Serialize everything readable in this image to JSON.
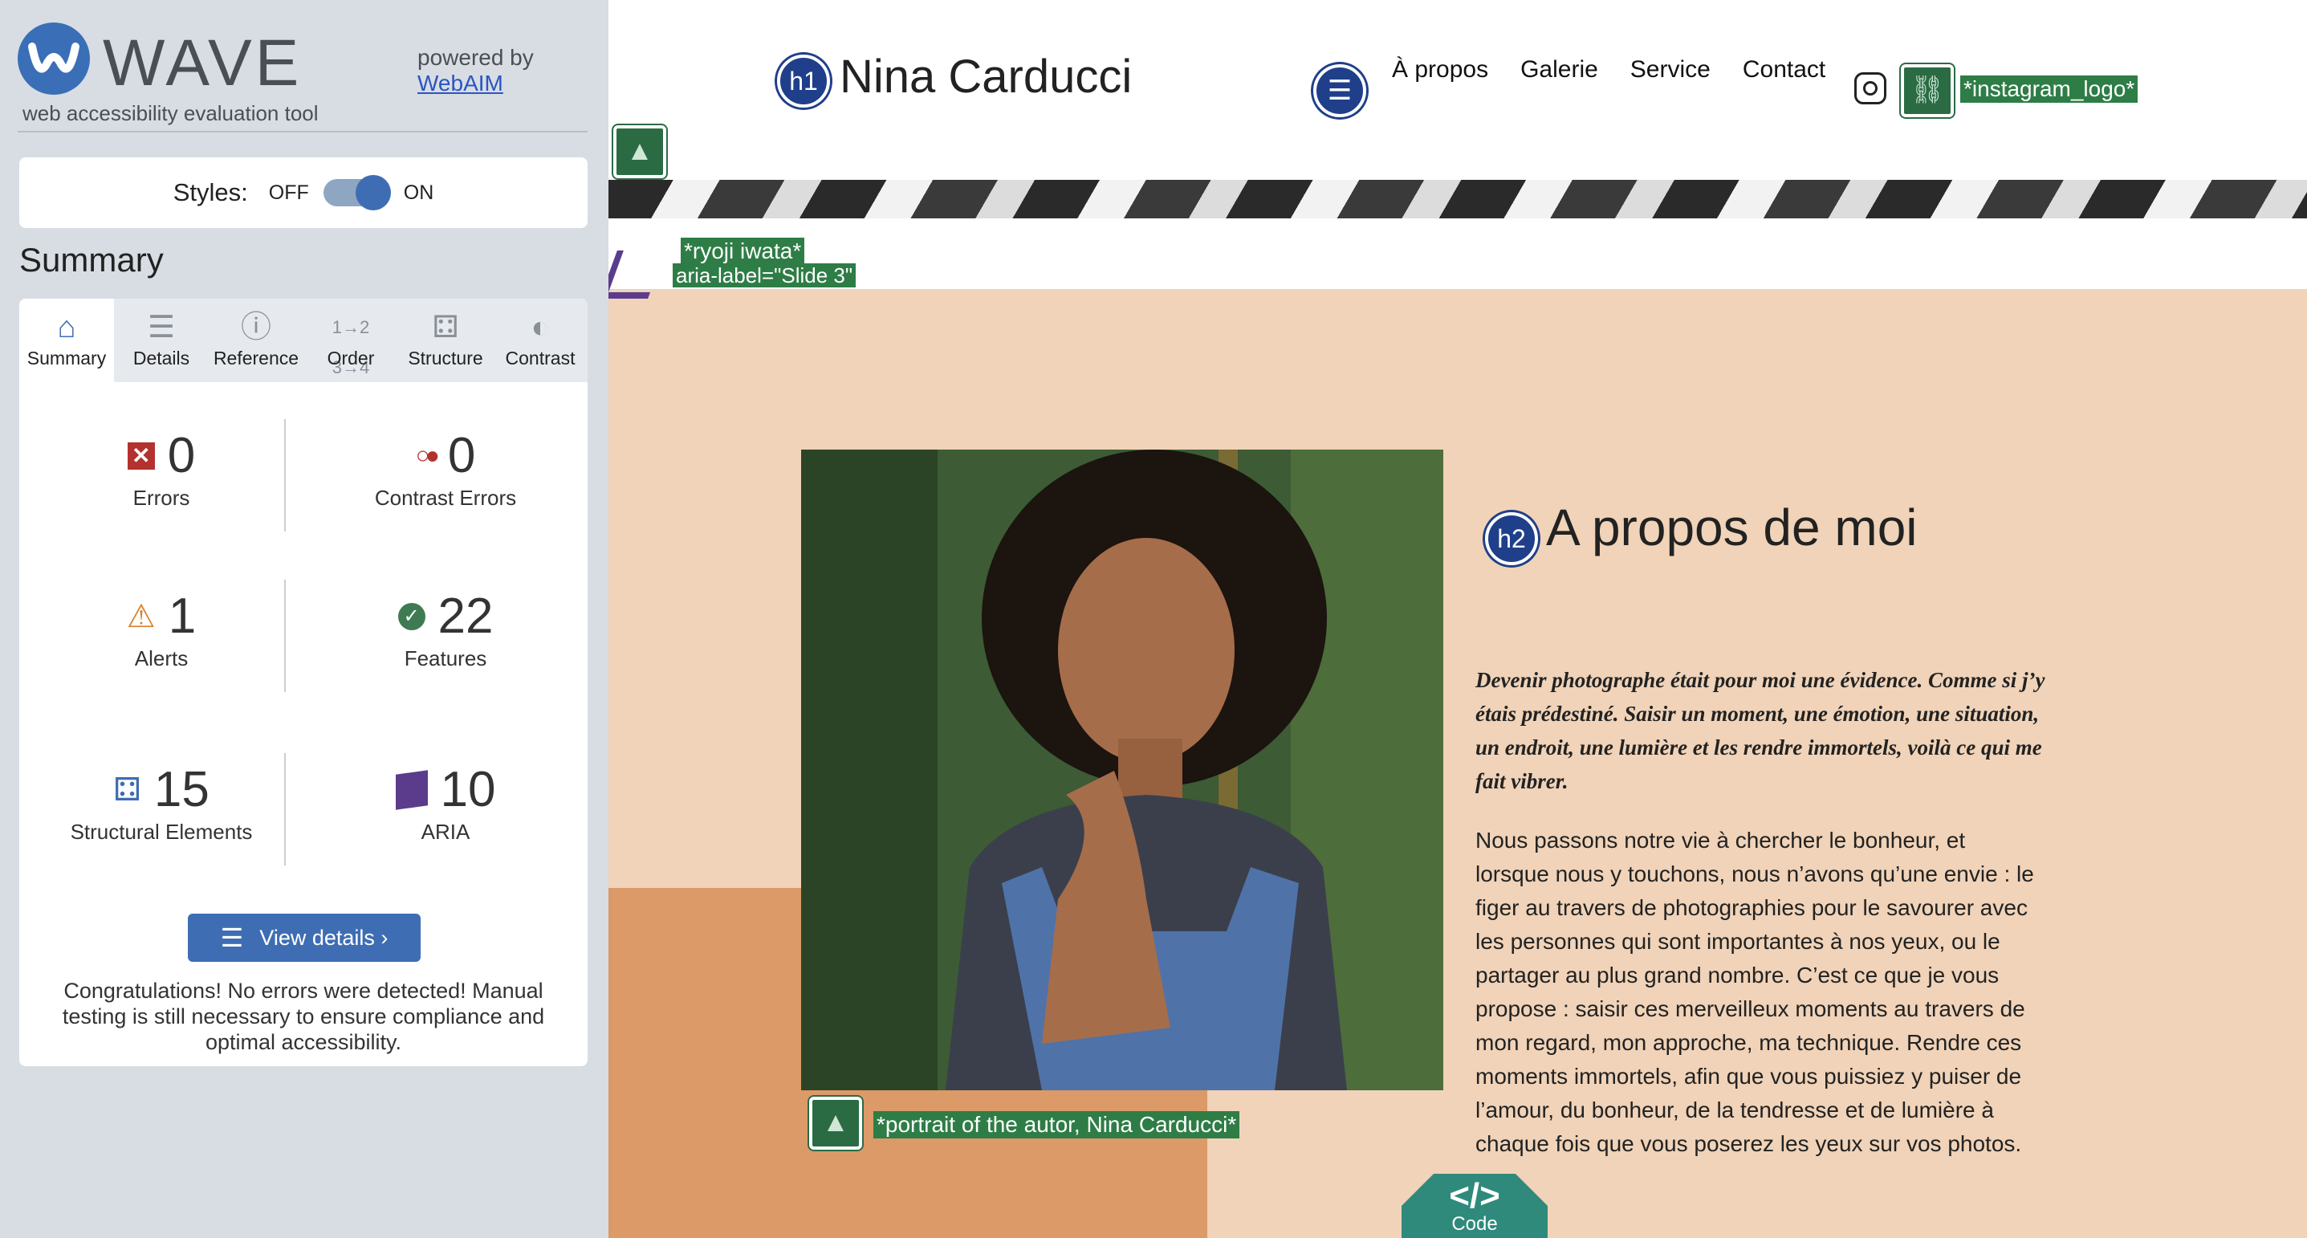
{
  "wave": {
    "logo_text": "WAVE",
    "tagline": "web accessibility evaluation tool",
    "powered_by": "powered by",
    "webaim_link": "WebAIM",
    "styles_label": "Styles:",
    "styles_off": "OFF",
    "styles_on": "ON",
    "summary_heading": "Summary",
    "tabs": [
      {
        "label": "Summary",
        "icon": "home-icon"
      },
      {
        "label": "Details",
        "icon": "list-icon"
      },
      {
        "label": "Reference",
        "icon": "info-icon"
      },
      {
        "label": "Order",
        "icon": "order-icon"
      },
      {
        "label": "Structure",
        "icon": "structure-icon"
      },
      {
        "label": "Contrast",
        "icon": "contrast-icon"
      }
    ],
    "stats": {
      "errors": {
        "count": "0",
        "label": "Errors"
      },
      "contrast_errors": {
        "count": "0",
        "label": "Contrast Errors"
      },
      "alerts": {
        "count": "1",
        "label": "Alerts"
      },
      "features": {
        "count": "22",
        "label": "Features"
      },
      "structural": {
        "count": "15",
        "label": "Structural Elements"
      },
      "aria": {
        "count": "10",
        "label": "ARIA"
      }
    },
    "view_details": "View details ›",
    "congrats": "Congratulations! No errors were detected! Manual testing is still necessary to ensure compliance and optimal accessibility."
  },
  "site": {
    "h1_badge": "h1",
    "title": "Nina Carducci",
    "nav": [
      "À propos",
      "Galerie",
      "Service",
      "Contact"
    ],
    "instagram_alt": "*instagram_logo*",
    "hero_alt": "*ryoji iwata*",
    "aria_label": "aria-label=\"Slide 3\"",
    "h2_badge": "h2",
    "about_title": "A propos de moi",
    "quote": "Devenir photographe était pour moi une évidence. Comme si j’y étais prédestiné. Saisir un moment, une émotion, une situation, un endroit, une lumière et les rendre immortels, voilà ce qui me fait vibrer.",
    "body": "Nous passons notre vie à chercher le bonheur, et lorsque nous y touchons, nous n’avons qu’une envie : le figer au travers de photographies pour le savourer avec les personnes qui sont importantes à nos yeux, ou le partager au plus grand nombre. C’est ce que je vous propose : saisir ces merveilleux moments au travers de mon regard, mon approche, ma technique. Rendre ces moments immortels, afin que vous puissiez y puiser de l’amour, du bonheur, de la tendresse et de lumière à chaque fois que vous poserez les yeux sur vos photos.",
    "portrait_alt": "*portrait of the autor, Nina Carducci*",
    "code_button": "</>",
    "code_label": "Code"
  }
}
